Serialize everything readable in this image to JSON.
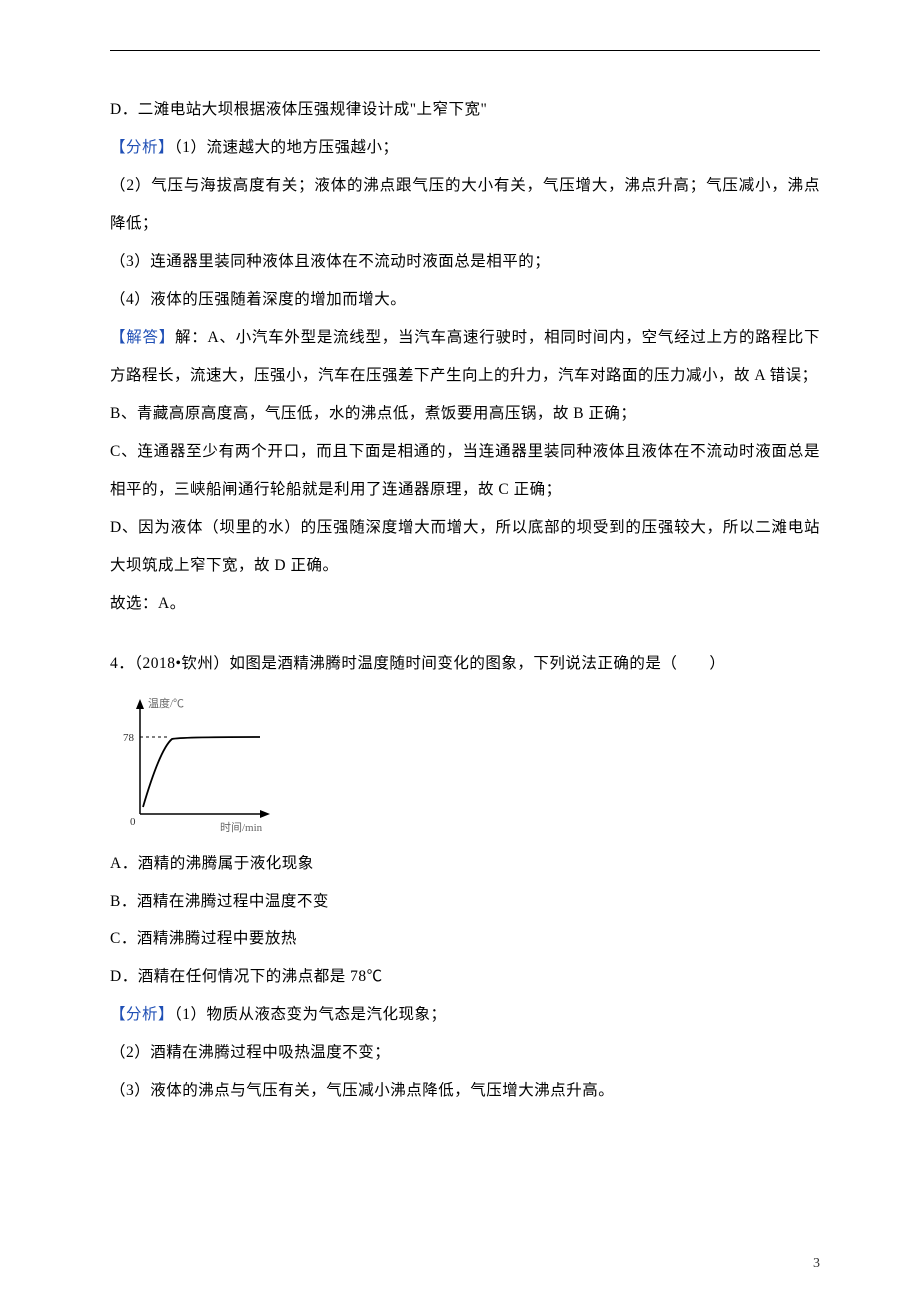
{
  "p_d": "D．二滩电站大坝根据液体压强规律设计成\"上窄下宽\"",
  "a_lbl": "【分析】",
  "a1": "（1）流速越大的地方压强越小；",
  "a2": "（2）气压与海拔高度有关；液体的沸点跟气压的大小有关，气压增大，沸点升高；气压减小，沸点降低；",
  "a3": "（3）连通器里装同种液体且液体在不流动时液面总是相平的；",
  "a4": "（4）液体的压强随着深度的增加而增大。",
  "s_lbl": "【解答】",
  "s_a": "解：A、小汽车外型是流线型，当汽车高速行驶时，相同时间内，空气经过上方的路程比下方路程长，流速大，压强小，汽车在压强差下产生向上的升力，汽车对路面的压力减小，故 A 错误；",
  "s_b": "B、青藏高原高度高，气压低，水的沸点低，煮饭要用高压锅，故 B 正确；",
  "s_c": "C、连通器至少有两个开口，而且下面是相通的，当连通器里装同种液体且液体在不流动时液面总是相平的，三峡船闸通行轮船就是利用了连通器原理，故 C 正确；",
  "s_d": "D、因为液体（坝里的水）的压强随深度增大而增大，所以底部的坝受到的压强较大，所以二滩电站大坝筑成上窄下宽，故 D 正确。",
  "s_pick": "故选：A。",
  "q4_stem": "4．（2018•钦州）如图是酒精沸腾时温度随时间变化的图象，下列说法正确的是（　　）",
  "q4_a": "A．酒精的沸腾属于液化现象",
  "q4_b": "B．酒精在沸腾过程中温度不变",
  "q4_c": "C．酒精沸腾过程中要放热",
  "q4_d": "D．酒精在任何情况下的沸点都是 78℃",
  "q4_an1": "（1）物质从液态变为气态是汽化现象；",
  "q4_an2": "（2）酒精在沸腾过程中吸热温度不变；",
  "q4_an3": "（3）液体的沸点与气压有关，气压减小沸点降低，气压增大沸点升高。",
  "chart_data": {
    "type": "line",
    "title": "",
    "xlabel": "时间/min",
    "ylabel": "温度/℃",
    "x": [
      0,
      1,
      2,
      3,
      4,
      5,
      6,
      7,
      8
    ],
    "y": [
      20,
      45,
      65,
      76,
      78,
      78,
      78,
      78,
      78
    ],
    "ylim": [
      0,
      90
    ],
    "annotations": [
      {
        "text": "78",
        "x": 0,
        "y": 78,
        "style": "y-tick-dashed"
      }
    ]
  },
  "fig": {
    "ylabel": "温度/℃",
    "xlabel": "时间/min",
    "ytick": "78",
    "origin": "0"
  },
  "page_number": "3"
}
